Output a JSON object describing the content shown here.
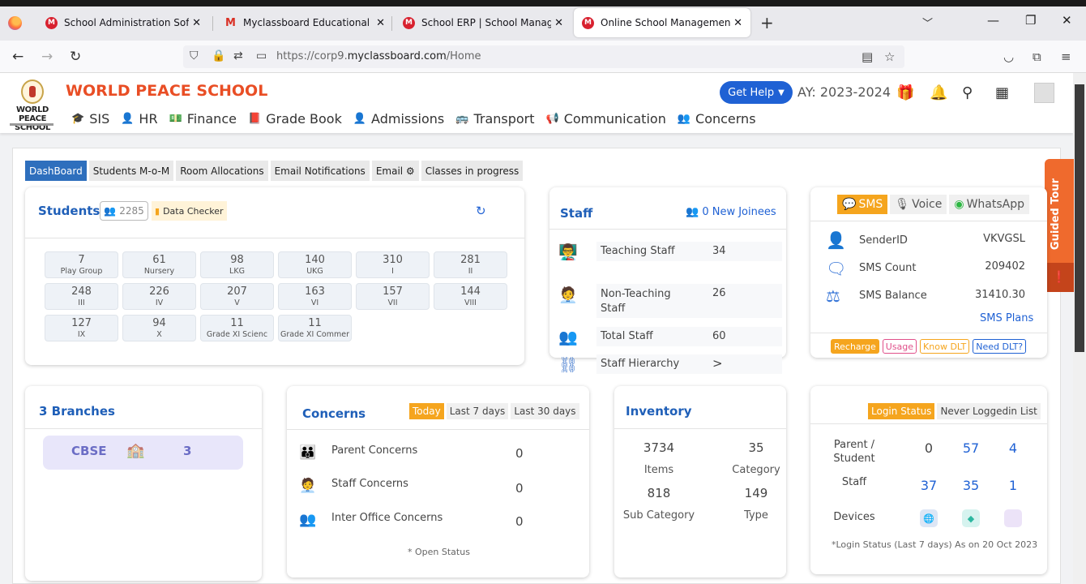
{
  "browser": {
    "tabs": [
      {
        "title": "School Administration Software",
        "favicon": "M"
      },
      {
        "title": "Myclassboard Educational Solut",
        "favicon": "M"
      },
      {
        "title": "School ERP | School Manageme",
        "favicon": "M"
      },
      {
        "title": "Online School Management Sol",
        "favicon": "M"
      }
    ],
    "new_tab": "+",
    "url_prefix": "https://corp9.",
    "url_domain": "myclassboard.com",
    "url_path": "/Home"
  },
  "header": {
    "logo_text": "WORLD PEACE SCHOOL",
    "school_name": "WORLD PEACE SCHOOL",
    "menu": [
      {
        "label": "SIS",
        "icon": "graduation-cap-icon",
        "glyph": "🎓"
      },
      {
        "label": "HR",
        "icon": "person-icon",
        "glyph": "👤"
      },
      {
        "label": "Finance",
        "icon": "money-icon",
        "glyph": "💵"
      },
      {
        "label": "Grade Book",
        "icon": "book-icon",
        "glyph": "📕"
      },
      {
        "label": "Admissions",
        "icon": "person-icon",
        "glyph": "👤"
      },
      {
        "label": "Transport",
        "icon": "bus-icon",
        "glyph": "🚌"
      },
      {
        "label": "Communication",
        "icon": "bullhorn-icon",
        "glyph": "📢"
      },
      {
        "label": "Concerns",
        "icon": "group-icon",
        "glyph": "👥"
      }
    ],
    "get_help": "Get Help",
    "academic_year": "AY: 2023-2024"
  },
  "subtabs": [
    {
      "label": "DashBoard",
      "active": true
    },
    {
      "label": "Students M-o-M",
      "active": false
    },
    {
      "label": "Room Allocations",
      "active": false
    },
    {
      "label": "Email Notifications",
      "active": false
    },
    {
      "label": "Email ⚙",
      "active": false
    },
    {
      "label": "Classes in progress",
      "active": false
    }
  ],
  "guided_tour": "Guided Tour",
  "students": {
    "title": "Students",
    "count": "2285",
    "data_checker": "Data Checker",
    "grades": [
      {
        "n": "7",
        "g": "Play Group"
      },
      {
        "n": "61",
        "g": "Nursery"
      },
      {
        "n": "98",
        "g": "LKG"
      },
      {
        "n": "140",
        "g": "UKG"
      },
      {
        "n": "310",
        "g": "I"
      },
      {
        "n": "281",
        "g": "II"
      },
      {
        "n": "248",
        "g": "III"
      },
      {
        "n": "226",
        "g": "IV"
      },
      {
        "n": "207",
        "g": "V"
      },
      {
        "n": "163",
        "g": "VI"
      },
      {
        "n": "157",
        "g": "VII"
      },
      {
        "n": "144",
        "g": "VIII"
      },
      {
        "n": "127",
        "g": "IX"
      },
      {
        "n": "94",
        "g": "X"
      },
      {
        "n": "11",
        "g": "Grade XI Scienc"
      },
      {
        "n": "11",
        "g": "Grade XI Commer"
      }
    ]
  },
  "staff": {
    "title": "Staff",
    "joinees": "0 New Joinees",
    "rows": [
      {
        "label": "Teaching Staff",
        "value": "34"
      },
      {
        "label": "Non-Teaching Staff",
        "value": "26"
      },
      {
        "label": "Total Staff",
        "value": "60"
      },
      {
        "label": "Staff Hierarchy",
        "value": ">"
      }
    ]
  },
  "sms": {
    "tabs": [
      "SMS",
      "Voice",
      "WhatsApp"
    ],
    "rows": [
      {
        "label": "SenderID",
        "value": "VKVGSL"
      },
      {
        "label": "SMS Count",
        "value": "209402"
      },
      {
        "label": "SMS Balance",
        "value": "31410.30"
      }
    ],
    "plans": "SMS Plans",
    "buttons": [
      {
        "label": "Recharge",
        "color": "#f5a51e"
      },
      {
        "label": "Usage",
        "color": "#e0508a"
      },
      {
        "label": "Know DLT",
        "color": "#f5a51e"
      },
      {
        "label": "Need DLT?",
        "color": "#1f61d4"
      }
    ]
  },
  "branches": {
    "title": "3 Branches",
    "board": "CBSE",
    "count": "3"
  },
  "concerns": {
    "title": "Concerns",
    "periods": [
      "Today",
      "Last 7 days",
      "Last 30 days"
    ],
    "rows": [
      {
        "label": "Parent Concerns",
        "value": "0"
      },
      {
        "label": "Staff Concerns",
        "value": "0"
      },
      {
        "label": "Inter Office Concerns",
        "value": "0"
      }
    ],
    "note": "* Open Status"
  },
  "inventory": {
    "title": "Inventory",
    "items": [
      {
        "value": "3734",
        "label": "Items"
      },
      {
        "value": "35",
        "label": "Category"
      },
      {
        "value": "818",
        "label": "Sub Category"
      },
      {
        "value": "149",
        "label": "Type"
      }
    ]
  },
  "login": {
    "tabs": [
      "Login Status",
      "Never Loggedin List"
    ],
    "rows": [
      {
        "label": "Parent / Student",
        "values": [
          "0",
          "57",
          "4"
        ]
      },
      {
        "label": "Staff",
        "values": [
          "37",
          "35",
          "1"
        ]
      }
    ],
    "devices_label": "Devices",
    "note": "*Login Status (Last 7 days) As on 20 Oct 2023"
  }
}
